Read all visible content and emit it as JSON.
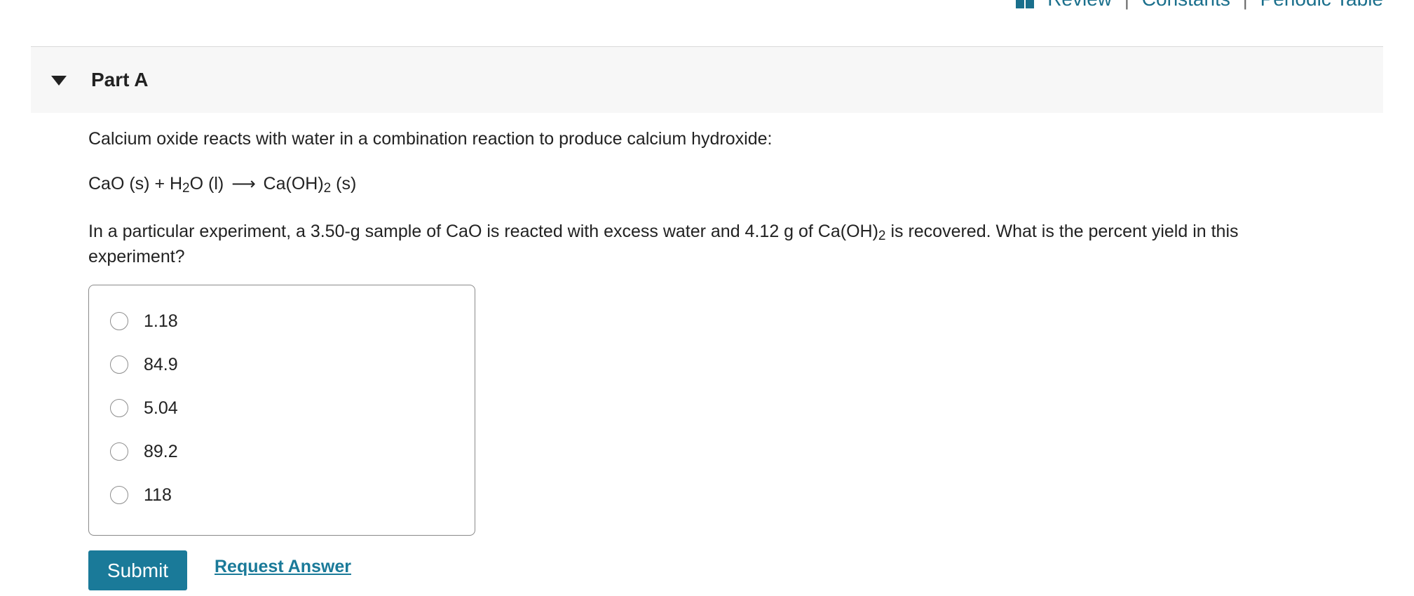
{
  "top_links": {
    "review": "Review",
    "sep1": "|",
    "constants": "Constants",
    "sep2": "|",
    "periodic_table": "Periodic Table"
  },
  "part": {
    "title": "Part A"
  },
  "problem": {
    "intro": "Calcium oxide reacts with water in a combination reaction to produce calcium hydroxide:",
    "equation": {
      "reactant1": "CaO (s) + H",
      "h2o_sub": "2",
      "reactant2": "O (l)",
      "arrow": "⟶",
      "product1": "Ca(OH)",
      "product_sub": "2",
      "product2": " (s)"
    },
    "question_part1": "In a particular experiment, a 3.50-g sample of CaO is reacted with excess water and 4.12 g of Ca(OH)",
    "question_sub": "2",
    "question_part2": " is recovered. What is the percent yield in this experiment?"
  },
  "choices": [
    {
      "label": "1.18"
    },
    {
      "label": "84.9"
    },
    {
      "label": "5.04"
    },
    {
      "label": "89.2"
    },
    {
      "label": "118"
    }
  ],
  "actions": {
    "submit_label": "Submit",
    "request_answer_label": "Request Answer"
  },
  "colors": {
    "accent": "#1a7a99",
    "header_bg": "#f7f7f7"
  }
}
